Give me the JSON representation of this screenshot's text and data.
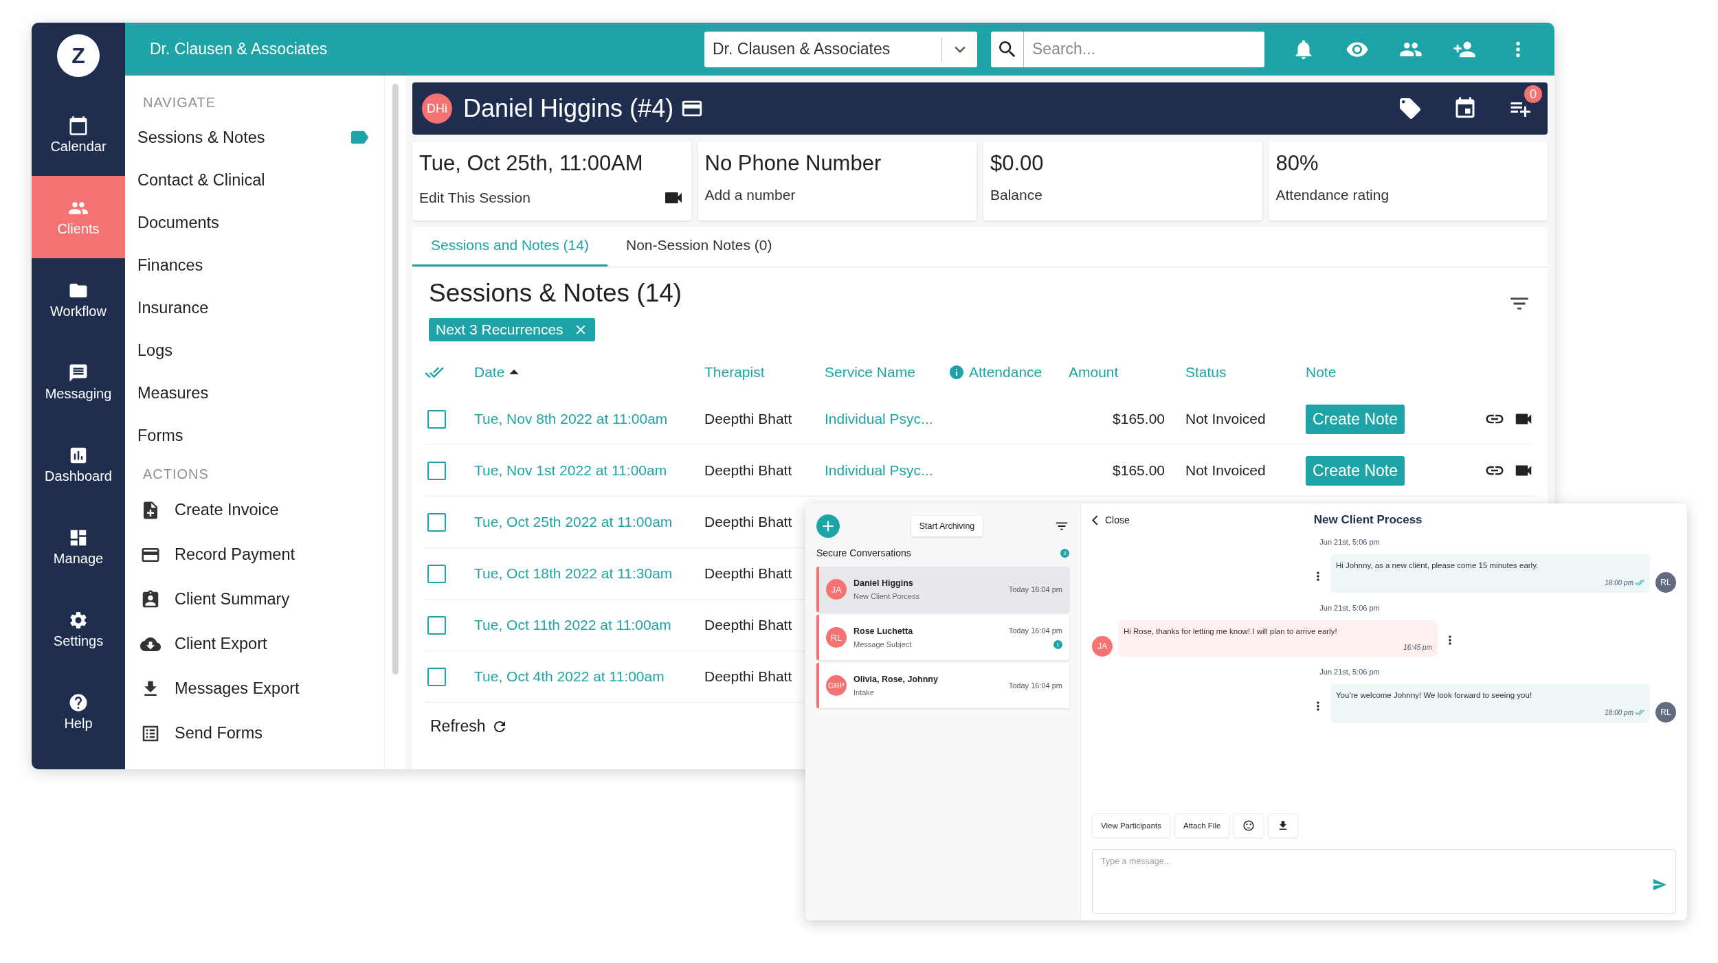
{
  "app_bar": {
    "title": "Dr. Clausen & Associates",
    "practice_select": {
      "value": "Dr. Clausen & Associates"
    },
    "search": {
      "placeholder": "Search..."
    }
  },
  "sidebar": {
    "logo": "Z",
    "items": [
      {
        "label": "Calendar",
        "selected": false
      },
      {
        "label": "Clients",
        "selected": true
      },
      {
        "label": "Workflow",
        "selected": false
      },
      {
        "label": "Messaging",
        "selected": false
      },
      {
        "label": "Dashboard",
        "selected": false
      },
      {
        "label": "Manage",
        "selected": false
      },
      {
        "label": "Settings",
        "selected": false
      },
      {
        "label": "Help",
        "selected": false
      }
    ]
  },
  "nav": {
    "sections": [
      {
        "title": "NAVIGATE",
        "kind": "links",
        "items": [
          {
            "label": "Sessions & Notes",
            "selected": true
          },
          {
            "label": "Contact & Clinical",
            "selected": false
          },
          {
            "label": "Documents",
            "selected": false
          },
          {
            "label": "Finances",
            "selected": false
          },
          {
            "label": "Insurance",
            "selected": false
          },
          {
            "label": "Logs",
            "selected": false
          },
          {
            "label": "Measures",
            "selected": false
          },
          {
            "label": "Forms",
            "selected": false
          }
        ]
      },
      {
        "title": "ACTIONS",
        "kind": "actions",
        "items": [
          {
            "label": "Create Invoice",
            "selected": false
          },
          {
            "label": "Record Payment",
            "selected": false
          },
          {
            "label": "Client Summary",
            "selected": false
          },
          {
            "label": "Client Export",
            "selected": false
          },
          {
            "label": "Messages Export",
            "selected": false
          },
          {
            "label": "Send Forms",
            "selected": false
          }
        ]
      }
    ]
  },
  "client_header": {
    "initials": "DHi",
    "name": "Daniel Higgins (#4)",
    "queue_count": "0"
  },
  "cards": [
    {
      "value": "Tue, Oct 25th, 11:00AM",
      "label": "Edit This Session",
      "video": true
    },
    {
      "value": "No Phone Number",
      "label": "Add a number",
      "video": false
    },
    {
      "value": "$0.00",
      "label": "Balance",
      "video": false
    },
    {
      "value": "80%",
      "label": "Attendance rating",
      "video": false
    }
  ],
  "tabs": [
    {
      "label": "Sessions and Notes (14)",
      "selected": true
    },
    {
      "label": "Non-Session Notes (0)",
      "selected": false
    }
  ],
  "section": {
    "title": "Sessions & Notes (14)",
    "filter_chip": "Next 3 Recurrences"
  },
  "table": {
    "columns": [
      {
        "label": "Date",
        "sorted": true
      },
      {
        "label": "Therapist",
        "sorted": false
      },
      {
        "label": "Service Name",
        "sorted": false
      },
      {
        "label": "Attendance",
        "sorted": false
      },
      {
        "label": "Amount",
        "sorted": false
      },
      {
        "label": "Status",
        "sorted": false
      },
      {
        "label": "Note",
        "sorted": false
      }
    ],
    "rows": [
      {
        "checked": false,
        "date": "Tue, Nov 8th 2022 at 11:00am",
        "therapist": "Deepthi Bhatt",
        "service": "Individual Psyc...",
        "amount": "$165.00",
        "status": "Not Invoiced",
        "note_action": "Create Note"
      },
      {
        "checked": false,
        "date": "Tue, Nov 1st 2022 at 11:00am",
        "therapist": "Deepthi Bhatt",
        "service": "Individual Psyc...",
        "amount": "$165.00",
        "status": "Not Invoiced",
        "note_action": "Create Note"
      },
      {
        "checked": false,
        "date": "Tue, Oct 25th 2022 at 11:00am",
        "therapist": "Deepthi Bhatt"
      },
      {
        "checked": false,
        "date": "Tue, Oct 18th 2022 at 11:30am",
        "therapist": "Deepthi Bhatt"
      },
      {
        "checked": false,
        "date": "Tue, Oct 11th 2022 at 11:00am",
        "therapist": "Deepthi Bhatt"
      },
      {
        "checked": false,
        "date": "Tue, Oct 4th 2022 at 11:00am",
        "therapist": "Deepthi Bhatt"
      }
    ]
  },
  "refresh": "Refresh",
  "messaging": {
    "archive_button": "Start Archiving",
    "list_title": "Secure Conversations",
    "unread_total": "2",
    "conversations": [
      {
        "initials": "JA",
        "name": "Daniel Higgins",
        "subject": "New Client Porcess",
        "time": "Today 16:04 pm",
        "selected": true
      },
      {
        "initials": "RL",
        "name": "Rose Luchetta",
        "subject": "Message Subject",
        "time": "Today 16:04 pm",
        "unread": "1",
        "selected": false
      },
      {
        "initials": "GRP",
        "name": "Olivia, Rose, Johnny",
        "subject": "Intake",
        "time": "Today 16:04 pm",
        "selected": false
      }
    ],
    "chat": {
      "close": "Close",
      "title": "New Client Process",
      "messages": [
        {
          "date": "Jun 21st, 5:06 pm",
          "text": "Hi Johnny, as a new client, please come 15 minutes early.",
          "time": "18:00 pm",
          "initials": "RL",
          "outgoing": true
        },
        {
          "date": "Jun 21st, 5:06 pm",
          "text": "Hi Rose, thanks for letting me know! I will plan to arrive early!",
          "time": "16:45 pm",
          "initials": "JA",
          "outgoing": false
        },
        {
          "date": "Jun 21st, 5:06 pm",
          "text": "You’re welcome Johnny! We look forward to seeing you!",
          "time": "18:00 pm",
          "initials": "RL",
          "outgoing": true
        }
      ],
      "actions": [
        "View Participants",
        "Attach File"
      ],
      "composer": {
        "placeholder": "Type a message..."
      }
    }
  }
}
